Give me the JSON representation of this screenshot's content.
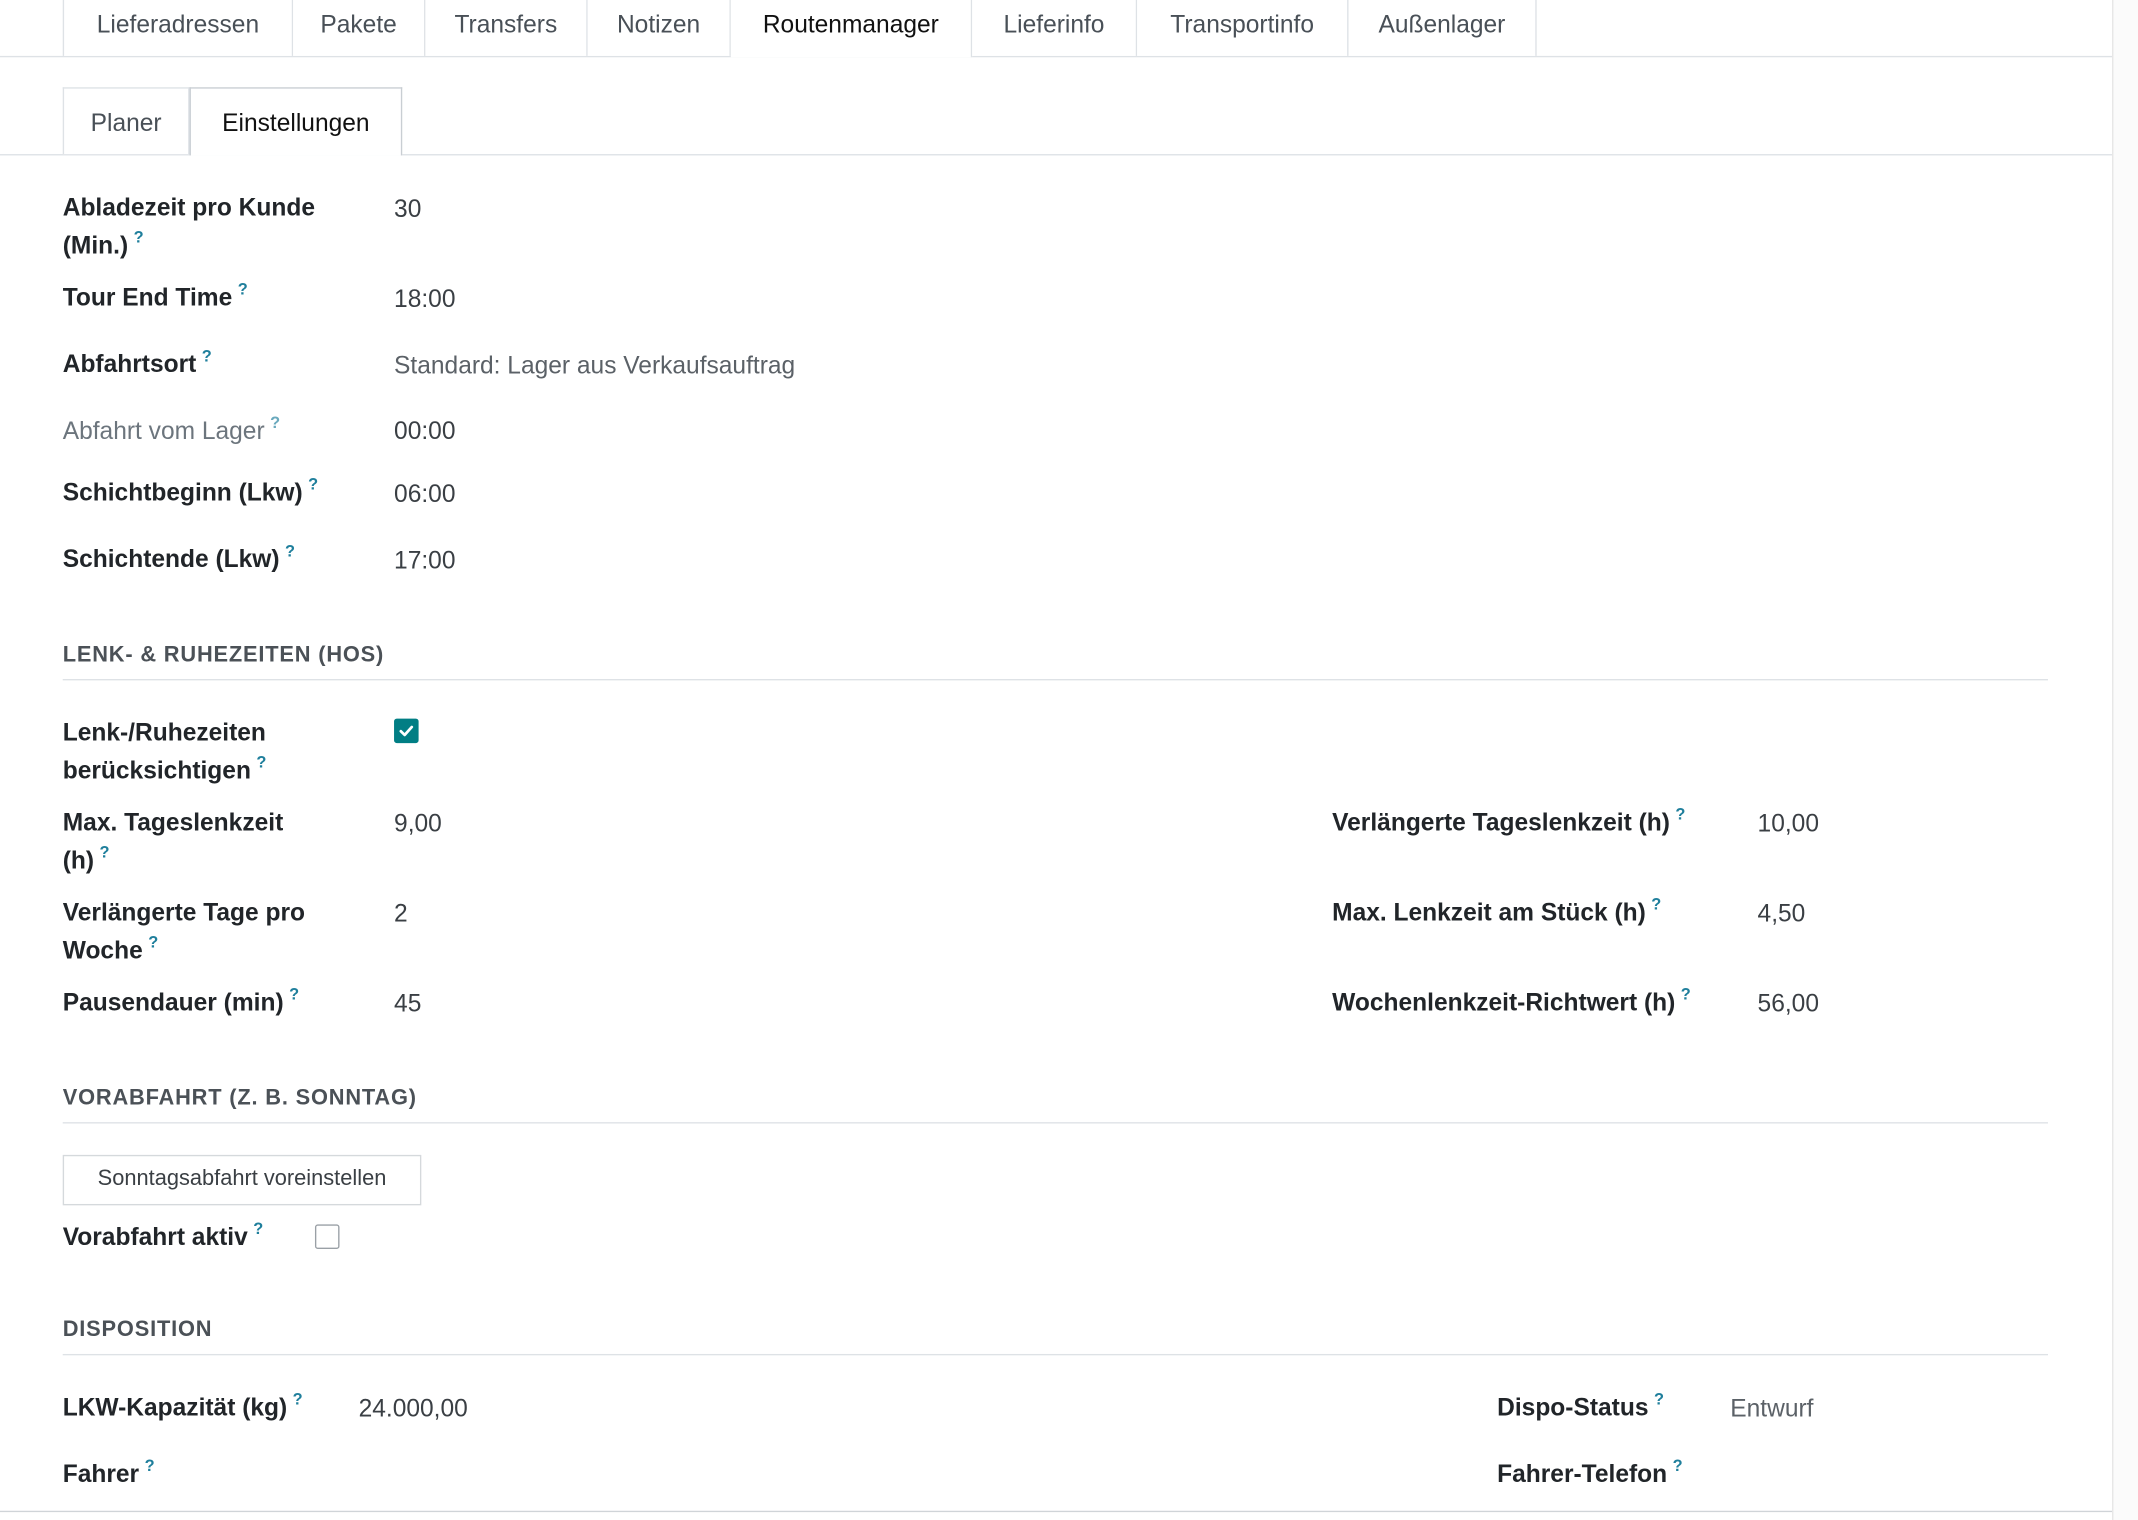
{
  "main_tabs": [
    "Lieferadressen",
    "Pakete",
    "Transfers",
    "Notizen",
    "Routenmanager",
    "Lieferinfo",
    "Transportinfo",
    "Außenlager"
  ],
  "sub_tabs": [
    "Planer",
    "Einstellungen"
  ],
  "help_mark": "?",
  "settings": {
    "abladezeit_label": "Abladezeit pro Kunde (Min.)",
    "abladezeit_value": "30",
    "tour_end_label": "Tour End Time",
    "tour_end_value": "18:00",
    "abfahrtsort_label": "Abfahrtsort",
    "abfahrtsort_value": "Standard: Lager aus Verkaufsauftrag",
    "abfahrt_lager_label": "Abfahrt vom Lager",
    "abfahrt_lager_value": "00:00",
    "schichtbeginn_label": "Schichtbeginn (Lkw)",
    "schichtbeginn_value": "06:00",
    "schichtende_label": "Schichtende (Lkw)",
    "schichtende_value": "17:00"
  },
  "hos": {
    "title": "LENK- & RUHEZEITEN (HOS)",
    "respect_label": "Lenk-/Ruhezeiten berücksichtigen",
    "respect_checked": true,
    "max_daily_label": "Max. Tageslenkzeit (h)",
    "max_daily_value": "9,00",
    "ext_daily_label": "Verlängerte Tageslenkzeit (h)",
    "ext_daily_value": "10,00",
    "ext_days_label": "Verlängerte Tage pro Woche",
    "ext_days_value": "2",
    "max_block_label": "Max. Lenkzeit am Stück (h)",
    "max_block_value": "4,50",
    "pause_label": "Pausendauer (min)",
    "pause_value": "45",
    "weekly_label": "Wochenlenkzeit-Richtwert (h)",
    "weekly_value": "56,00"
  },
  "pre_departure": {
    "title": "VORABFAHRT (Z. B. SONNTAG)",
    "button_label": "Sonntagsabfahrt voreinstellen",
    "active_label": "Vorabfahrt aktiv",
    "active_checked": false
  },
  "disposition": {
    "title": "DISPOSITION",
    "capacity_label": "LKW-Kapazität (kg)",
    "capacity_value": "24.000,00",
    "status_label": "Dispo-Status",
    "status_value": "Entwurf",
    "driver_label": "Fahrer",
    "driver_phone_label": "Fahrer-Telefon"
  },
  "colors": {
    "accent": "#017e84",
    "help": "#1f7f9c",
    "border": "#dee2e6"
  },
  "icons": {
    "checkbox_checked": "check-icon"
  }
}
